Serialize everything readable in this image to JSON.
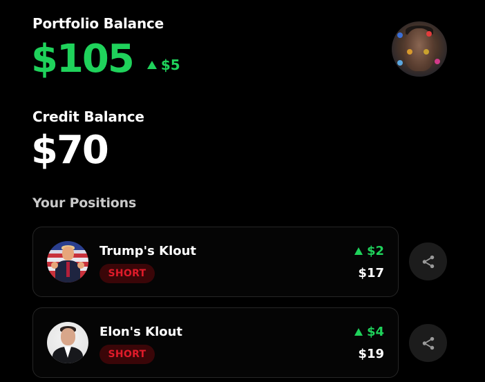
{
  "portfolio": {
    "label": "Portfolio Balance",
    "value": "$105",
    "change": "$5",
    "change_direction": "up"
  },
  "credit": {
    "label": "Credit Balance",
    "value": "$70"
  },
  "positions": {
    "label": "Your Positions",
    "items": [
      {
        "name": "Trump's Klout",
        "side": "SHORT",
        "change": "$2",
        "change_direction": "up",
        "value": "$17",
        "avatar": "trump-avatar"
      },
      {
        "name": "Elon's Klout",
        "side": "SHORT",
        "change": "$4",
        "change_direction": "up",
        "value": "$19",
        "avatar": "elon-avatar"
      }
    ]
  },
  "icons": {
    "share": "share-icon",
    "up_arrow": "triangle-up-icon"
  },
  "colors": {
    "background": "#000000",
    "positive": "#1fd25b",
    "short_text": "#e01b2a",
    "short_bg": "#3a0608",
    "card_border": "#262626",
    "share_bg": "#1c1c1c"
  }
}
